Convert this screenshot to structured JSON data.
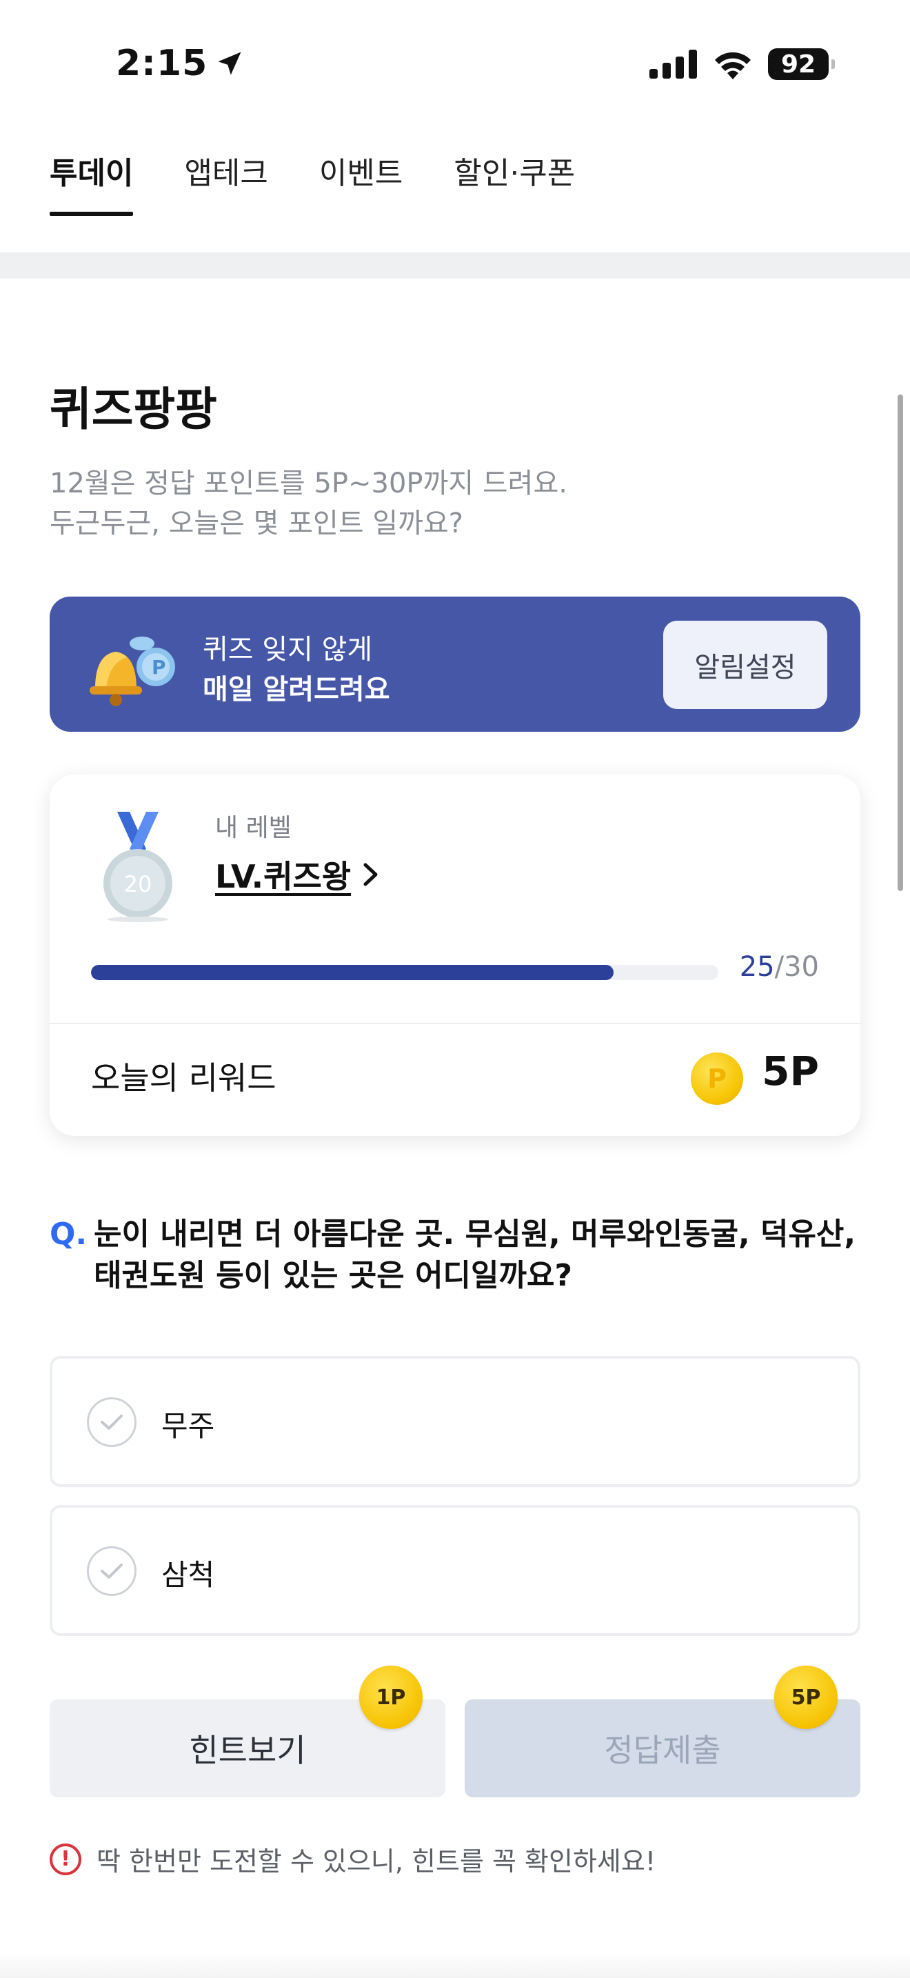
{
  "status_bar": {
    "time": "2:15",
    "battery": "92"
  },
  "tabs": [
    {
      "label": "투데이"
    },
    {
      "label": "앱테크"
    },
    {
      "label": "이벤트"
    },
    {
      "label": "할인·쿠폰"
    }
  ],
  "quiz": {
    "title": "퀴즈팡팡",
    "desc_line1": "12월은 정답 포인트를 5P~30P까지 드려요.",
    "desc_line2": "두근두근, 오늘은 몇 포인트 일까요?"
  },
  "banner": {
    "line1": "퀴즈 잊지 않게",
    "line2": "매일 알려드려요",
    "button": "알림설정"
  },
  "level_card": {
    "label": "내 레벨",
    "level_name": "LV.퀴즈왕",
    "medal_number": "20",
    "progress_current": "25",
    "progress_total": "/30",
    "progress_fraction": 0.833,
    "reward_label": "오늘의 리워드",
    "coin_symbol": "P",
    "reward_value": "5P"
  },
  "question": {
    "mark": "Q.",
    "text": "눈이 내리면 더 아름다운 곳. 무심원, 머루와인동굴, 덕유산, 태권도원 등이 있는 곳은 어디일까요?"
  },
  "options": [
    {
      "label": "무주"
    },
    {
      "label": "삼척"
    }
  ],
  "buttons": {
    "hint": "힌트보기",
    "hint_badge": "1P",
    "submit": "정답제출",
    "submit_badge": "5P"
  },
  "notice": {
    "icon": "!",
    "text": "딱 한번만 도전할 수 있으니, 힌트를 꼭 확인하세요!"
  }
}
